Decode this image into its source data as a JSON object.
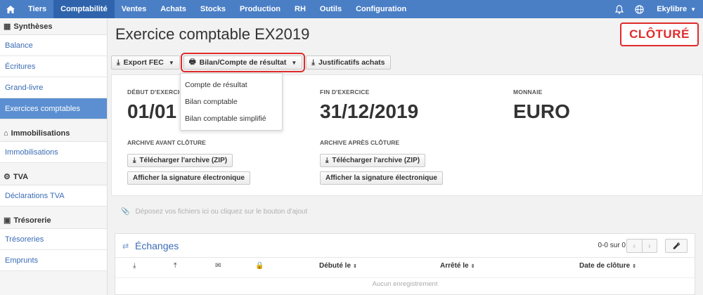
{
  "topnav": {
    "items": [
      "Tiers",
      "Comptabilité",
      "Ventes",
      "Achats",
      "Stocks",
      "Production",
      "RH",
      "Outils",
      "Configuration"
    ],
    "user": "Ekylibre"
  },
  "sidebar": {
    "syntheses": {
      "title": "Synthèses",
      "items": [
        "Balance",
        "Écritures",
        "Grand-livre",
        "Exercices comptables"
      ]
    },
    "immobilisations": {
      "title": "Immobilisations",
      "items": [
        "Immobilisations"
      ]
    },
    "tva": {
      "title": "TVA",
      "items": [
        "Déclarations TVA"
      ]
    },
    "tresorerie": {
      "title": "Trésorerie",
      "items": [
        "Trésoreries",
        "Emprunts"
      ]
    }
  },
  "page": {
    "title": "Exercice comptable EX2019",
    "status": "CLÔTURÉ"
  },
  "toolbar": {
    "export_fec": "Export FEC",
    "bilan": "Bilan/Compte de résultat",
    "justificatifs": "Justificatifs achats"
  },
  "dropdown": {
    "items": [
      "Compte de résultat",
      "Bilan comptable",
      "Bilan comptable simplifié"
    ]
  },
  "fields": {
    "debut_label": "DÉBUT D'EXERCICE",
    "debut_value": "01/01",
    "fin_label": "FIN D'EXERCICE",
    "fin_value": "31/12/2019",
    "monnaie_label": "MONNAIE",
    "monnaie_value": "EURO"
  },
  "archives": {
    "avant_label": "ARCHIVE AVANT CLÔTURE",
    "apres_label": "ARCHIVE APRÈS CLÔTURE",
    "download": "Télécharger l'archive (ZIP)",
    "signature": "Afficher la signature électronique"
  },
  "dropzone": {
    "text": "Déposez vos fichiers ici ou cliquez sur le bouton d'ajout"
  },
  "exchanges": {
    "title": "Échanges",
    "count": "0-0 sur 0",
    "columns": [
      "Débuté le",
      "Arrêté le",
      "Date de clôture"
    ],
    "empty": "Aucun enregistrement"
  }
}
